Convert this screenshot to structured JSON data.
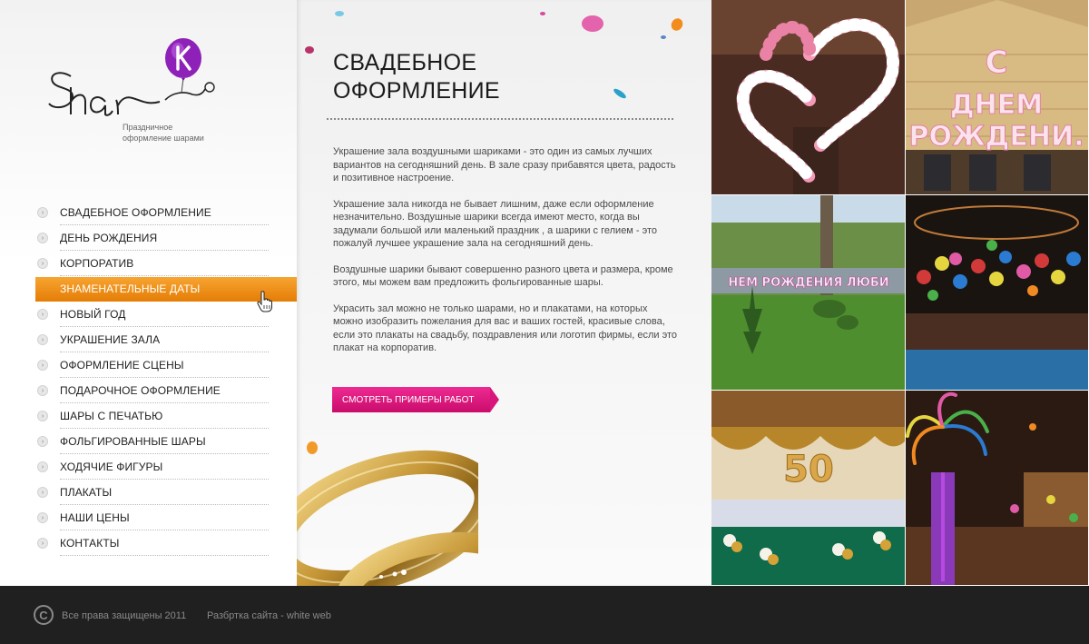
{
  "logo": {
    "wordmark": "Shar",
    "badge_letter": "K",
    "tagline": "Праздничное оформление шарами"
  },
  "menu": {
    "items": [
      {
        "label": "СВАДЕБНОЕ ОФОРМЛЕНИЕ"
      },
      {
        "label": "ДЕНЬ РОЖДЕНИЯ"
      },
      {
        "label": "КОРПОРАТИВ"
      },
      {
        "label": "ЗНАМЕНАТЕЛЬНЫЕ ДАТЫ"
      },
      {
        "label": "НОВЫЙ ГОД"
      },
      {
        "label": "УКРАШЕНИЕ ЗАЛА"
      },
      {
        "label": "ОФОРМЛЕНИЕ СЦЕНЫ"
      },
      {
        "label": "ПОДАРОЧНОЕ ОФОРМЛЕНИЕ"
      },
      {
        "label": "ШАРЫ С ПЕЧАТЬЮ"
      },
      {
        "label": "ФОЛЬГИРОВАННЫЕ ШАРЫ"
      },
      {
        "label": "ХОДЯЧИЕ ФИГУРЫ"
      },
      {
        "label": "ПЛАКАТЫ"
      },
      {
        "label": "НАШИ ЦЕНЫ"
      },
      {
        "label": "КОНТАКТЫ"
      }
    ],
    "active_index": 3
  },
  "main": {
    "title": "СВАДЕБНОЕ ОФОРМЛЕНИЕ",
    "paragraphs": [
      "Украшение зала воздушными шариками - это один из самых лучших вариантов на сегодняшний день. В зале сразу прибавятся цвета, радость и позитивное настроение.",
      "Украшение зала никогда не бывает лишним, даже если оформление незначительно. Воздушные шарики всегда имеют место, когда вы задумали большой или маленький праздник , а шарики с гелием - это пожалуй лучшее украшение зала на сегодняшний день.",
      "Воздушные шарики бывают совершенно разного цвета и размера, кроме этого, мы можем вам предложить фольгированные шары.",
      "Украсить зал можно не только шарами, но и плакатами, на которых можно изобразить пожелания для вас и ваших гостей, красивые слова, если это плакаты на свадьбу, поздравления или логотип фирмы, если это плакат на корпоратив."
    ],
    "cta_label": "СМОТРЕТЬ ПРИМЕРЫ РАБОТ"
  },
  "gallery": {
    "photos": [
      {
        "name": "hearts-balloon-arch-photo"
      },
      {
        "name": "birthday-letters-building-photo",
        "caption": "С ДНЕМ РОЖДЕНИ..."
      },
      {
        "name": "garden-banner-photo",
        "caption": "НЕМ РОЖДЕНИЯ ЛЮБИ"
      },
      {
        "name": "restaurant-balloons-photo"
      },
      {
        "name": "banquet-hall-50-photo",
        "caption": "50"
      },
      {
        "name": "balloon-palm-photo"
      }
    ]
  },
  "footer": {
    "copyright": "Все права защищены  2011",
    "developer": "Разбртка сайта - white web"
  },
  "colors": {
    "accent_orange": "#f0900f",
    "accent_pink": "#e3197f",
    "logo_purple": "#9b2cc4",
    "footer_bg": "#202020"
  }
}
